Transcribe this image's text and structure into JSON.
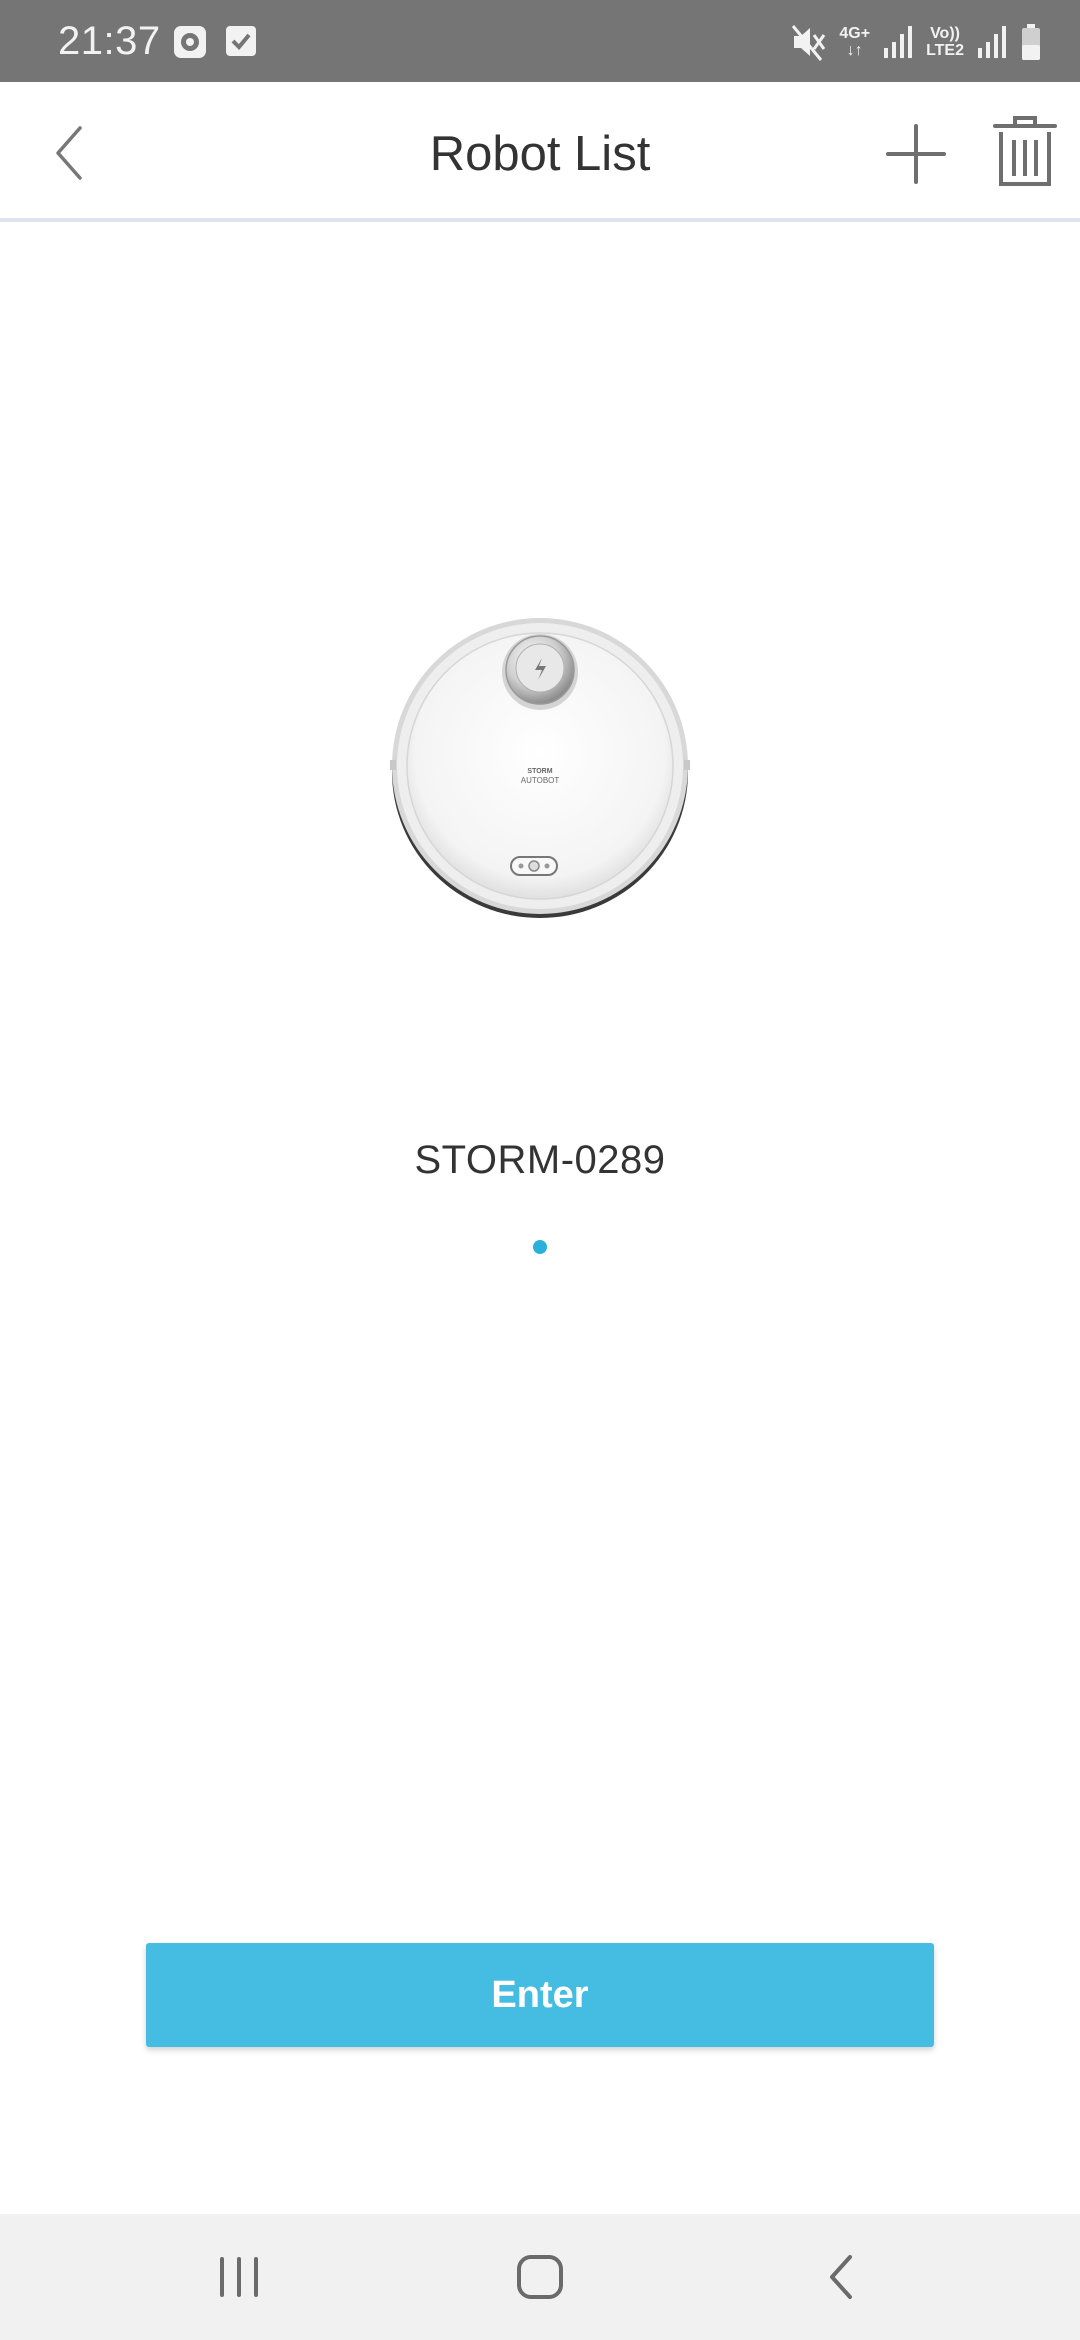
{
  "status_bar": {
    "time": "21:37",
    "left_icons": [
      "media-icon",
      "check-notification-icon"
    ],
    "right_icons": [
      "mute-icon",
      "network-4g-icon",
      "signal-icon",
      "volte-icon",
      "signal-icon-2",
      "battery-icon"
    ],
    "network_type": "4G+",
    "volte_top": "Vo))",
    "volte_bottom": "LTE2"
  },
  "header": {
    "title": "Robot List",
    "back_icon": "chevron-left-icon",
    "add_icon": "plus-icon",
    "delete_icon": "trash-icon"
  },
  "robot": {
    "name": "STORM-0289",
    "logo_line1": "STORM",
    "logo_line2": "AUTOBOT"
  },
  "pager": {
    "current_page": 1,
    "total_pages": 1,
    "active_color": "#2bb0dc"
  },
  "actions": {
    "enter_label": "Enter",
    "accent_color": "#45bde3"
  },
  "nav_bar": {
    "items": [
      "recents-icon",
      "home-icon",
      "back-icon"
    ]
  }
}
